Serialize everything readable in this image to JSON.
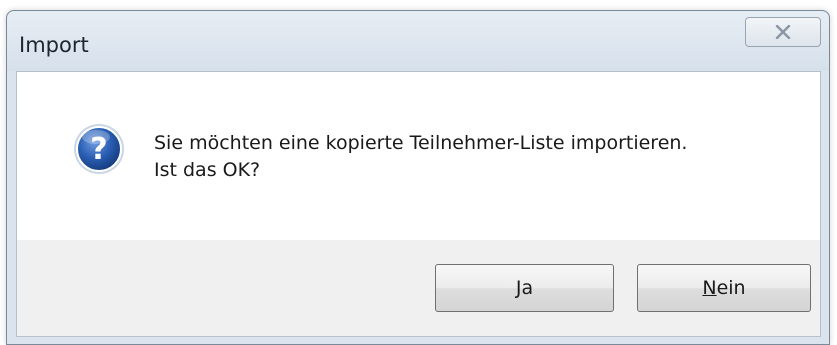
{
  "window": {
    "title": "Import"
  },
  "message": {
    "line1": "Sie möchten eine kopierte Teilnehmer-Liste importieren.",
    "line2": "Ist das OK?",
    "icon": "question-icon"
  },
  "buttons": {
    "yes": {
      "mnemonic": "J",
      "rest": "a"
    },
    "no": {
      "mnemonic": "N",
      "rest": "ein"
    }
  },
  "colors": {
    "icon_blue": "#2a5fb4",
    "titlebar": "#dbe4ee"
  }
}
